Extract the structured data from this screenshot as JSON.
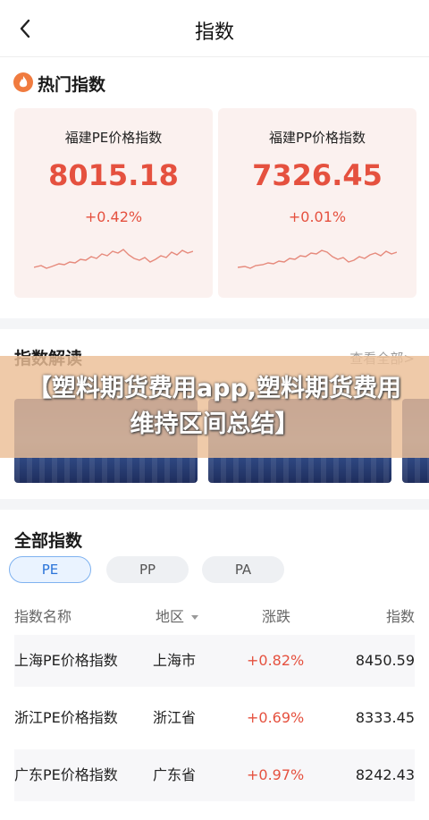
{
  "header": {
    "title": "指数",
    "back_icon": "chevron-left-icon"
  },
  "hot": {
    "title": "热门指数",
    "icon": "flame-icon",
    "cards": [
      {
        "name": "福建PE价格指数",
        "value": "8015.18",
        "change": "+0.42%"
      },
      {
        "name": "福建PP价格指数",
        "value": "7326.45",
        "change": "+0.01%"
      }
    ]
  },
  "reading": {
    "title": "指数解读",
    "more": "查看全部>",
    "overlay": "【塑料期货费用app,塑料期货费用维持区间总结】"
  },
  "all": {
    "title": "全部指数",
    "tabs": [
      "PE",
      "PP",
      "PA"
    ],
    "active_tab": "PE",
    "columns": [
      "指数名称",
      "地区",
      "涨跌",
      "指数"
    ],
    "rows": [
      {
        "name": "上海PE价格指数",
        "region": "上海市",
        "change": "+0.82%",
        "index": "8450.59"
      },
      {
        "name": "浙江PE价格指数",
        "region": "浙江省",
        "change": "+0.69%",
        "index": "8333.45"
      },
      {
        "name": "广东PE价格指数",
        "region": "广东省",
        "change": "+0.97%",
        "index": "8242.43"
      }
    ]
  },
  "colors": {
    "accent_red": "#e5513f",
    "accent_blue": "#2a73d9",
    "card_bg": "#fbf1ef"
  }
}
